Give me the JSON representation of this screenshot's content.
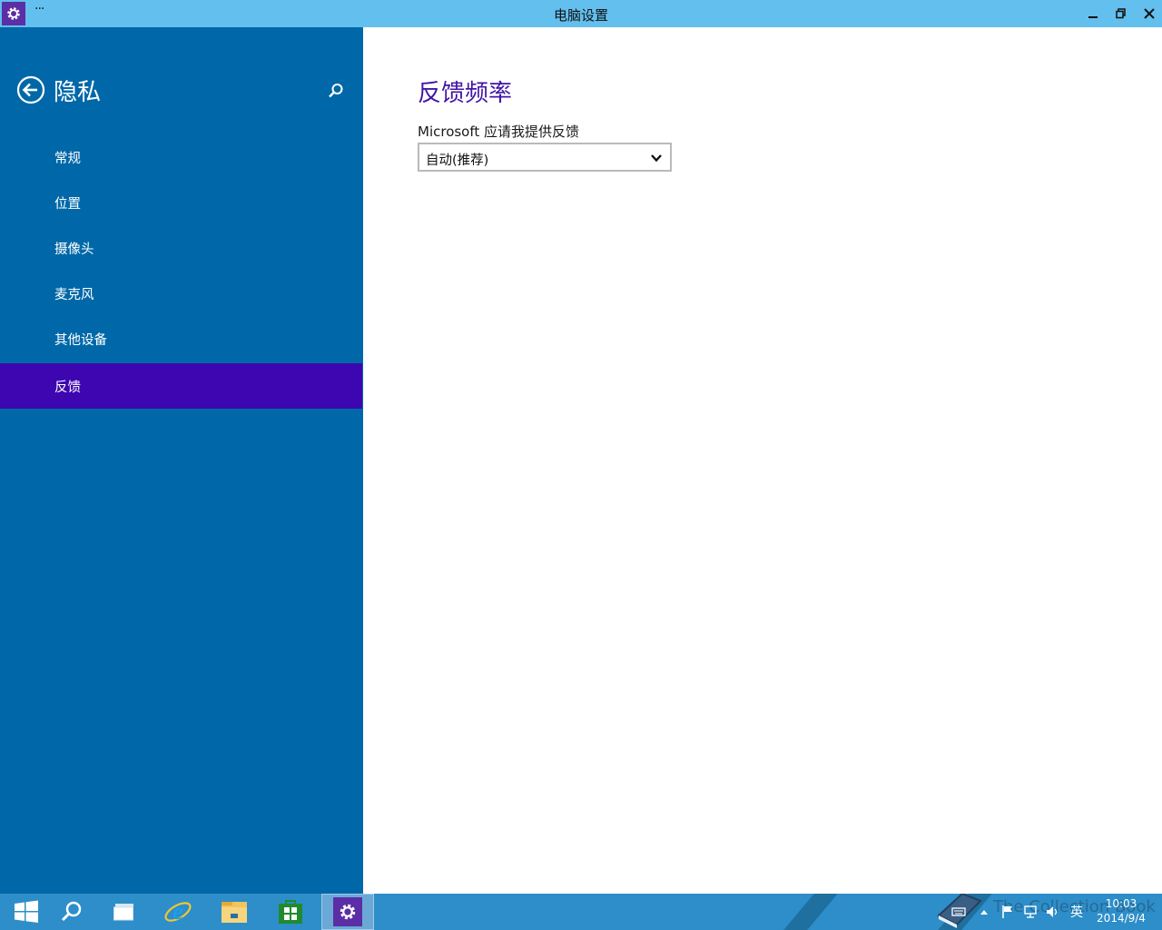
{
  "window": {
    "title": "电脑设置",
    "menu_dots": "···"
  },
  "sidebar": {
    "title": "隐私",
    "items": [
      {
        "label": "常规"
      },
      {
        "label": "位置"
      },
      {
        "label": "摄像头"
      },
      {
        "label": "麦克风"
      },
      {
        "label": "其他设备"
      },
      {
        "label": "反馈",
        "selected": true
      }
    ]
  },
  "content": {
    "section_title": "反馈频率",
    "field_label": "Microsoft 应请我提供反馈",
    "dropdown_value": "自动(推荐)"
  },
  "taskbar": {
    "items": [
      "start-icon",
      "search-icon",
      "task-view-icon",
      "ie-icon",
      "file-explorer-icon",
      "store-icon",
      "settings-icon"
    ],
    "active_item": "settings-icon",
    "tray": {
      "ime": "英",
      "time": "10:03",
      "date": "2014/9/4",
      "watermark": "The Collection Book"
    }
  },
  "colors": {
    "titlebar": "#62bfee",
    "sidebar": "#0068a8",
    "sidebar_selected": "#3d06b0",
    "accent_text": "#4114a6",
    "taskbar": "#2d8ec9"
  }
}
